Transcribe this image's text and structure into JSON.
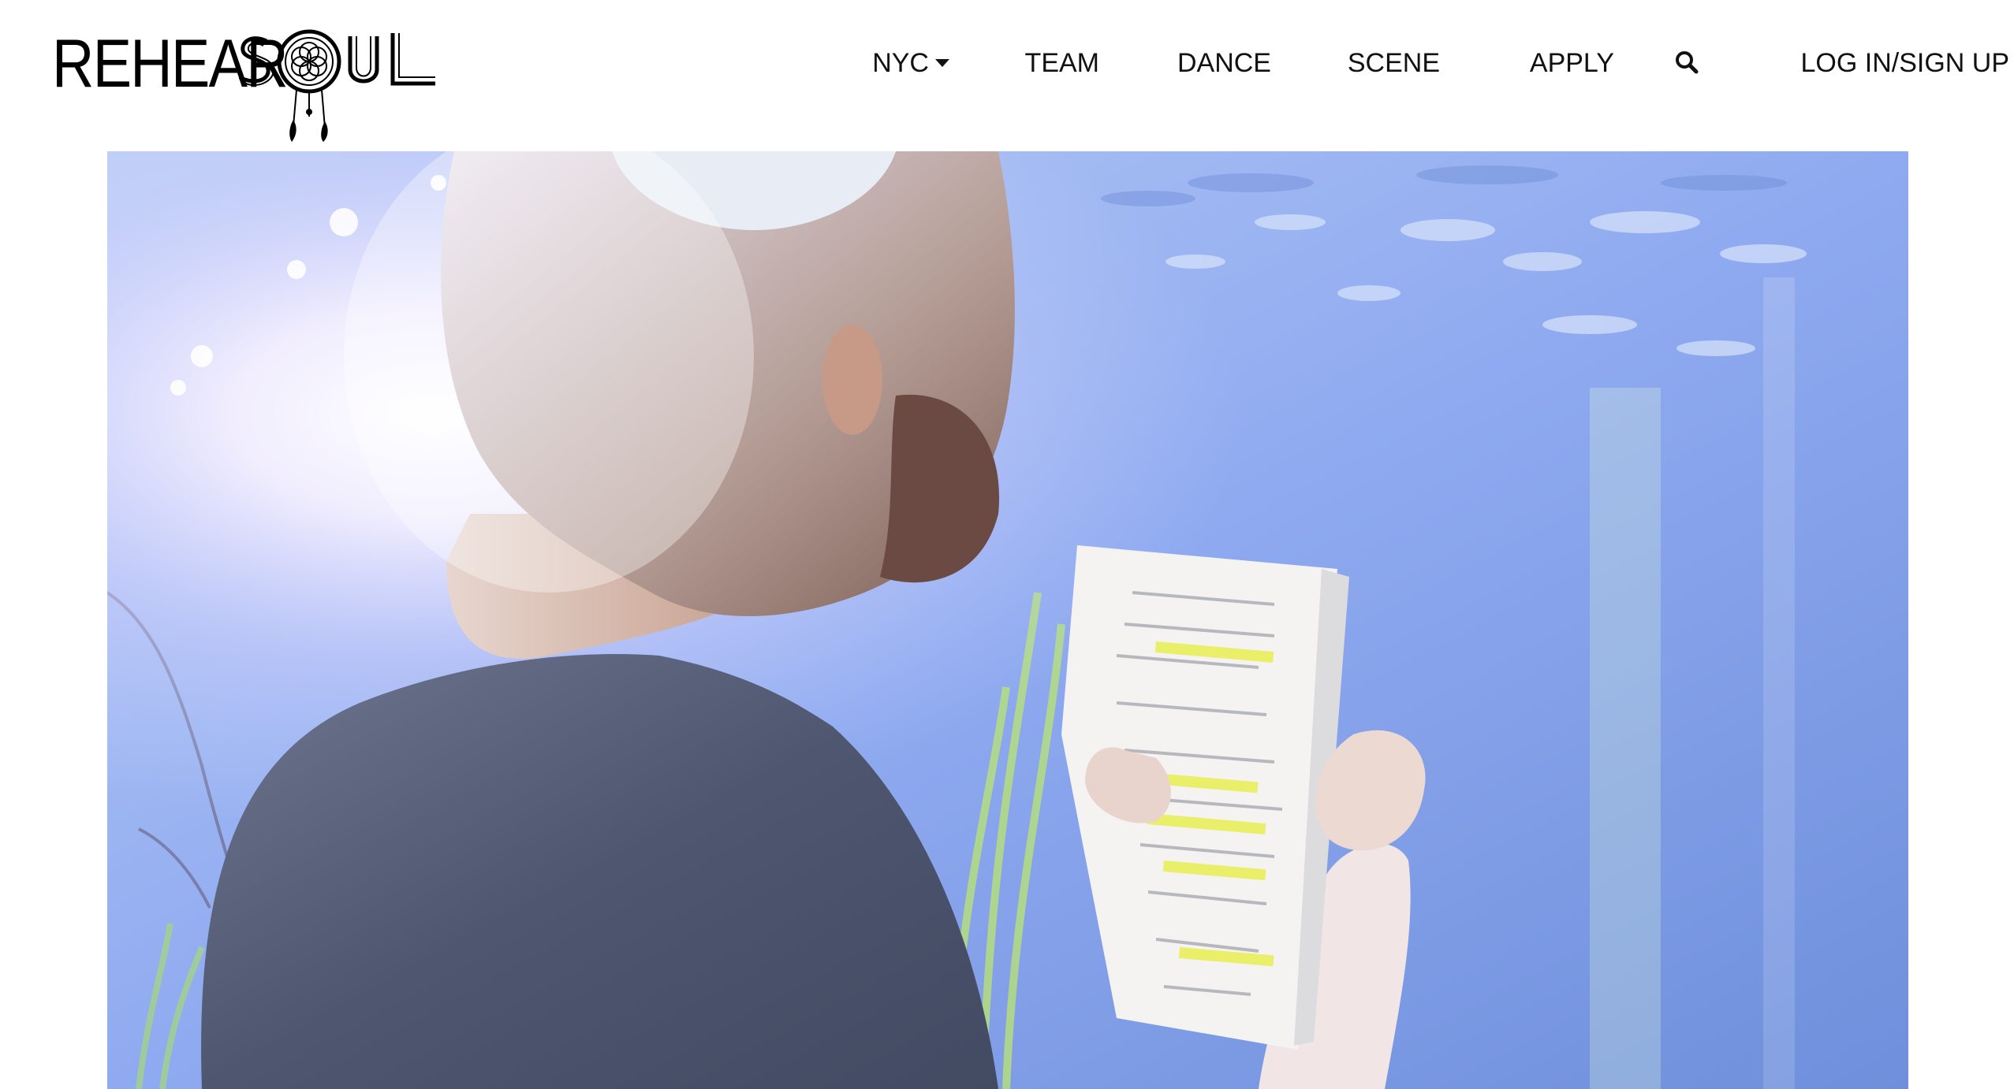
{
  "brand": {
    "logo_text": "REHEARSOUL"
  },
  "nav": {
    "items": [
      {
        "key": "nyc",
        "label": "NYC"
      },
      {
        "key": "team",
        "label": "TEAM"
      },
      {
        "key": "dance",
        "label": "DANCE"
      },
      {
        "key": "scene",
        "label": "SCENE"
      },
      {
        "key": "apply",
        "label": "APPLY"
      }
    ],
    "login_label": "LOG IN/SIGN UP",
    "search_icon": "search-icon",
    "dropdown_icon": "caret-down-icon"
  },
  "hero": {
    "image_subject": "man reading a highlighted script beside sunlit water"
  },
  "colors": {
    "nav_text": "#111111",
    "water": "#7e9fe6",
    "highlight": "#e9ef52"
  }
}
